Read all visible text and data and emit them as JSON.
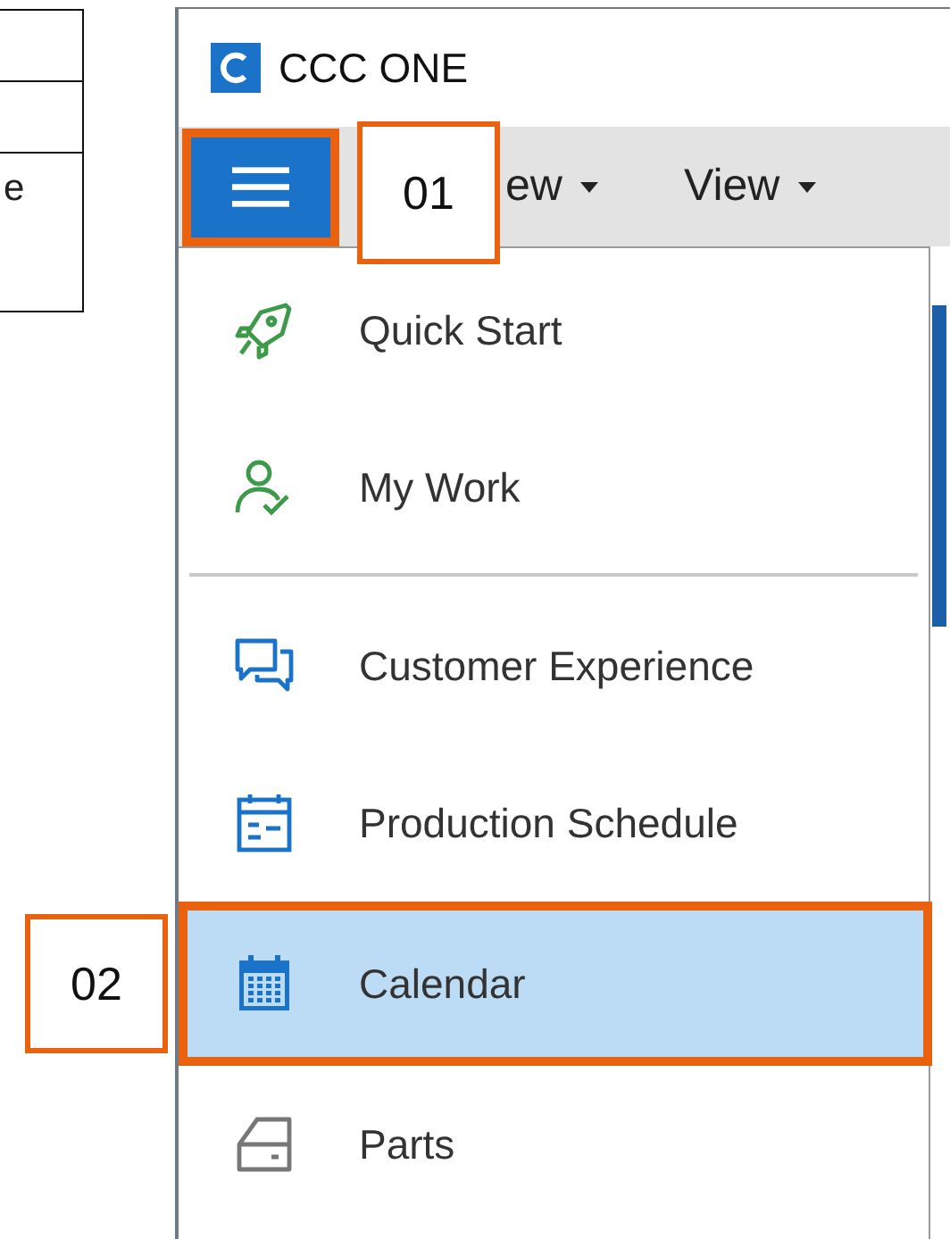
{
  "side_table": {
    "rows": [
      {},
      {},
      {
        "text": "e"
      }
    ]
  },
  "window": {
    "title": "CCC ONE"
  },
  "toolbar": {
    "menu_button": {
      "highlighted": true
    },
    "items": [
      {
        "label": "ew"
      },
      {
        "label": "View"
      }
    ]
  },
  "menu": {
    "items": [
      {
        "kind": "rocket",
        "label": "Quick Start",
        "selected": false,
        "highlighted": false,
        "separator_after": false
      },
      {
        "kind": "person-check",
        "label": "My Work",
        "selected": false,
        "highlighted": false,
        "separator_after": true
      },
      {
        "kind": "chat",
        "label": "Customer Experience",
        "selected": false,
        "highlighted": false,
        "separator_after": false
      },
      {
        "kind": "schedule",
        "label": "Production Schedule",
        "selected": false,
        "highlighted": false,
        "separator_after": false
      },
      {
        "kind": "calendar",
        "label": "Calendar",
        "selected": true,
        "highlighted": true,
        "separator_after": false
      },
      {
        "kind": "drawer",
        "label": "Parts",
        "selected": false,
        "highlighted": false,
        "separator_after": false
      }
    ]
  },
  "callouts": [
    {
      "label": "01"
    },
    {
      "label": "02"
    }
  ]
}
